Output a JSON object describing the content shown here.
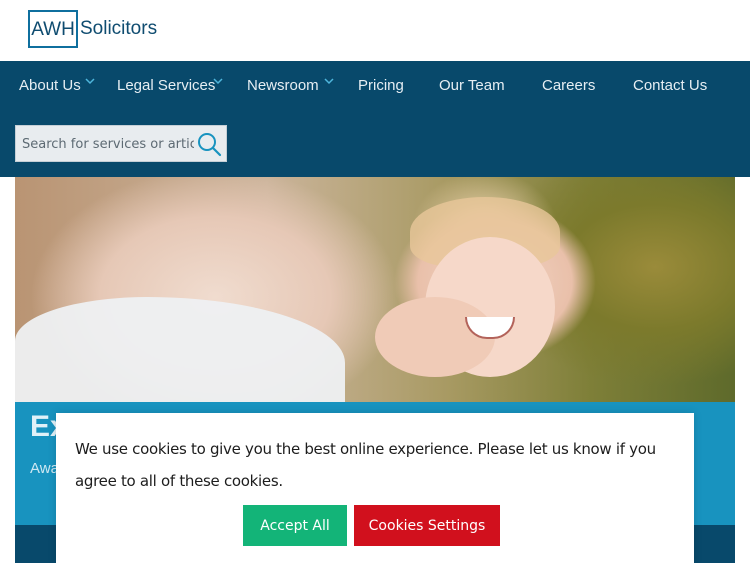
{
  "brand": {
    "logo_text": "AWH",
    "name": "Solicitors",
    "primary_color": "#08496b",
    "accent_color": "#1893bf"
  },
  "nav": {
    "items": [
      {
        "label": "About Us",
        "has_dropdown": true
      },
      {
        "label": "Legal Services",
        "has_dropdown": true
      },
      {
        "label": "Newsroom",
        "has_dropdown": true
      },
      {
        "label": "Pricing",
        "has_dropdown": false
      },
      {
        "label": "Our Team",
        "has_dropdown": false
      },
      {
        "label": "Careers",
        "has_dropdown": false
      },
      {
        "label": "Contact Us",
        "has_dropdown": false
      }
    ],
    "search_placeholder": "Search for services or articles",
    "search_icon": "search-icon"
  },
  "hero": {
    "title_partial": "Ex",
    "subtitle_partial": "Awa"
  },
  "cookie_banner": {
    "message": "We use cookies to give you the best online experience. Please let us know if you agree to all of these cookies.",
    "accept_label": "Accept All",
    "settings_label": "Cookies Settings",
    "accept_color": "#13b478",
    "settings_color": "#d1101d"
  }
}
